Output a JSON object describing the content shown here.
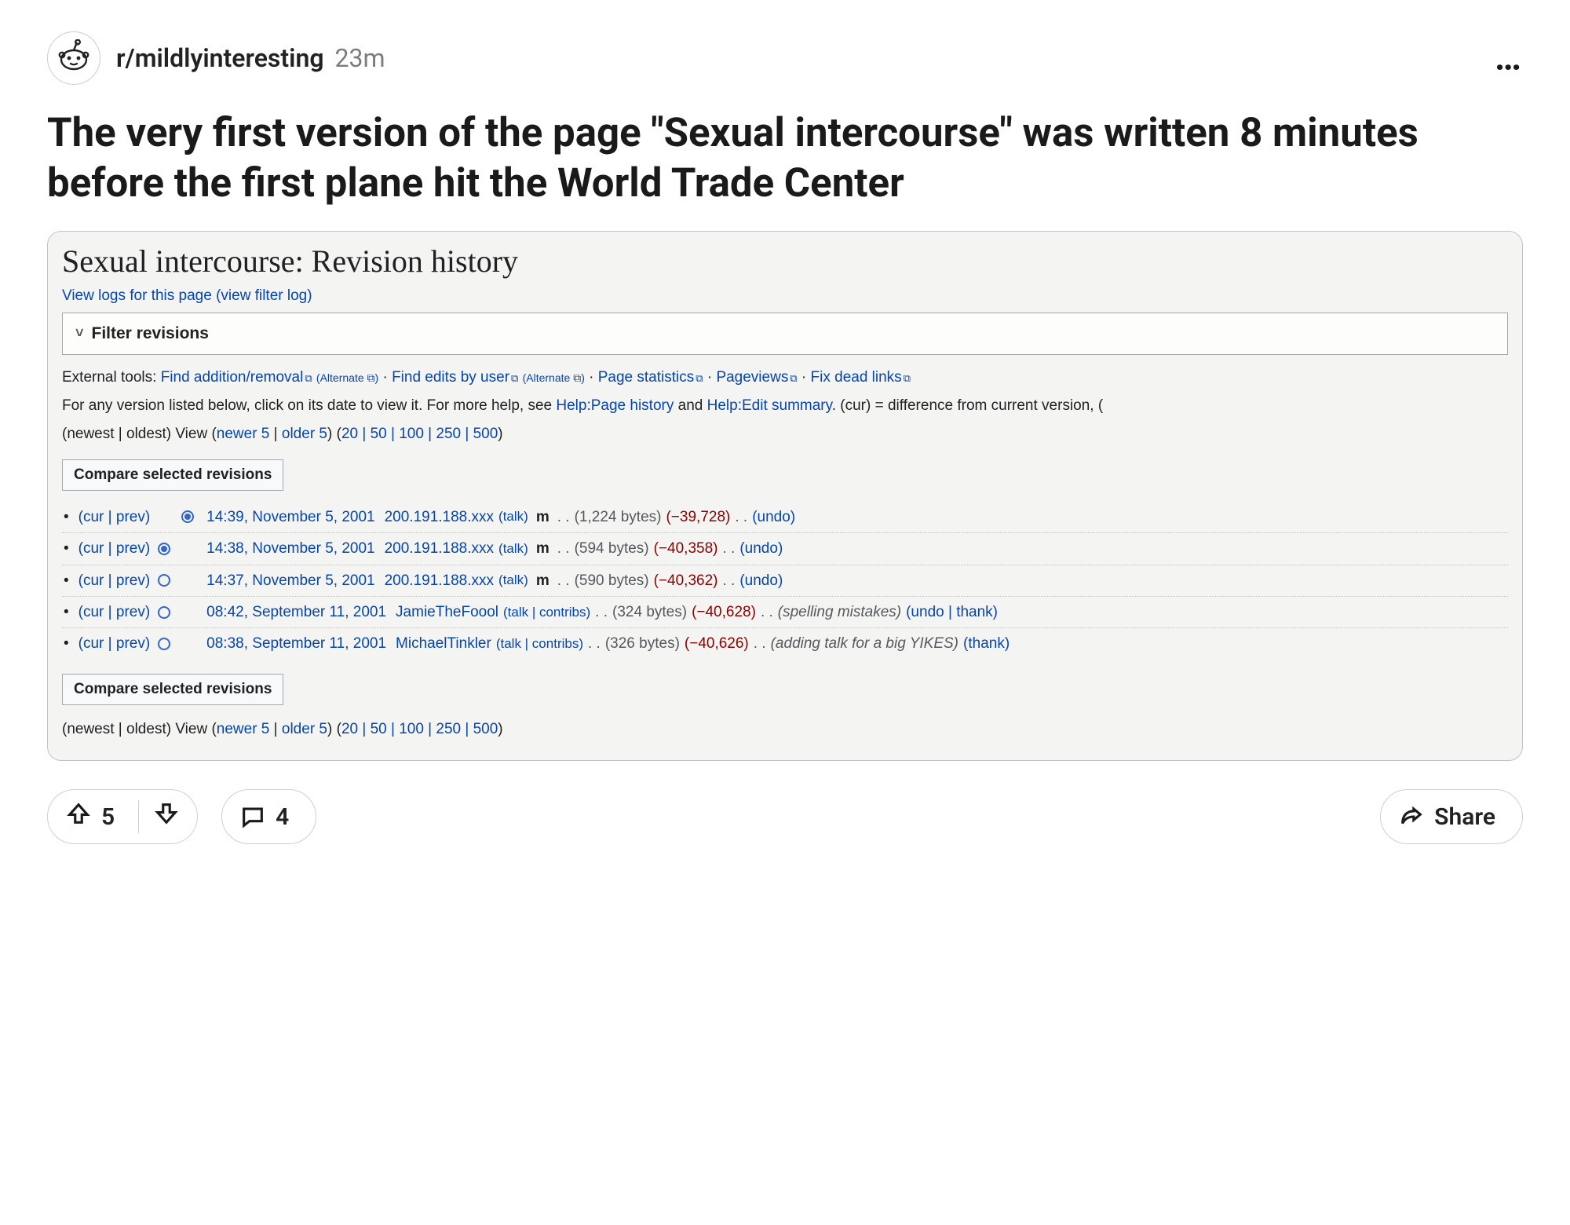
{
  "header": {
    "subreddit": "r/mildlyinteresting",
    "age": "23m"
  },
  "title": "The very first version of the page \"Sexual intercourse\" was written 8 minutes before the first plane hit the World Trade Center",
  "embed": {
    "page_title": "Sexual intercourse: Revision history",
    "view_logs": "View logs for this page (view filter log)",
    "filter_label": "Filter revisions",
    "external_tools_prefix": "External tools:",
    "tools": {
      "find_addremove": "Find addition/removal",
      "alt": "(Alternate ⧉)",
      "find_edits": "Find edits by user",
      "page_stats": "Page statistics",
      "pageviews": "Pageviews",
      "fix_dead": "Fix dead links"
    },
    "help_text_a": "For any version listed below, click on its date to view it. For more help, see ",
    "help_link1": "Help:Page history",
    "help_mid": " and ",
    "help_link2": "Help:Edit summary",
    "help_text_b": ". (cur) = difference from current version, (",
    "pager_a": "(newest | oldest) View (",
    "pager_newer": "newer 5",
    "pager_sep": " | ",
    "pager_older": "older 5",
    "pager_b": ") (",
    "pager_counts": "20 | 50 | 100 | 250 | 500",
    "pager_c": ")",
    "compare_label": "Compare selected revisions",
    "revisions": [
      {
        "curprev": "(cur | prev)",
        "radio1": "blank",
        "radio2": "selected",
        "date": "14:39, November 5, 2001",
        "user": "200.191.188.xxx",
        "usermeta": "(talk)",
        "minor": "m",
        "size": "(1,224 bytes)",
        "diff": "(−39,728)",
        "summary": "",
        "actions": "(undo)"
      },
      {
        "curprev": "(cur | prev)",
        "radio1": "selected",
        "radio2": "blank",
        "date": "14:38, November 5, 2001",
        "user": "200.191.188.xxx",
        "usermeta": "(talk)",
        "minor": "m",
        "size": "(594 bytes)",
        "diff": "(−40,358)",
        "summary": "",
        "actions": "(undo)"
      },
      {
        "curprev": "(cur | prev)",
        "radio1": "empty",
        "radio2": "blank",
        "date": "14:37, November 5, 2001",
        "user": "200.191.188.xxx",
        "usermeta": "(talk)",
        "minor": "m",
        "size": "(590 bytes)",
        "diff": "(−40,362)",
        "summary": "",
        "actions": "(undo)"
      },
      {
        "curprev": "(cur | prev)",
        "radio1": "empty",
        "radio2": "blank",
        "date": "08:42, September 11, 2001",
        "user": "JamieTheFoool",
        "usermeta": "(talk | contribs)",
        "minor": "",
        "size": "(324 bytes)",
        "diff": "(−40,628)",
        "summary": "(spelling mistakes)",
        "actions": "(undo | thank)"
      },
      {
        "curprev": "(cur | prev)",
        "radio1": "empty",
        "radio2": "blank",
        "date": "08:38, September 11, 2001",
        "user": "MichaelTinkler",
        "usermeta": "(talk | contribs)",
        "minor": "",
        "size": "(326 bytes)",
        "diff": "(−40,626)",
        "summary": "(adding talk for a big YIKES)",
        "actions": "(thank)"
      }
    ]
  },
  "footer": {
    "score": "5",
    "comments": "4",
    "share": "Share"
  }
}
